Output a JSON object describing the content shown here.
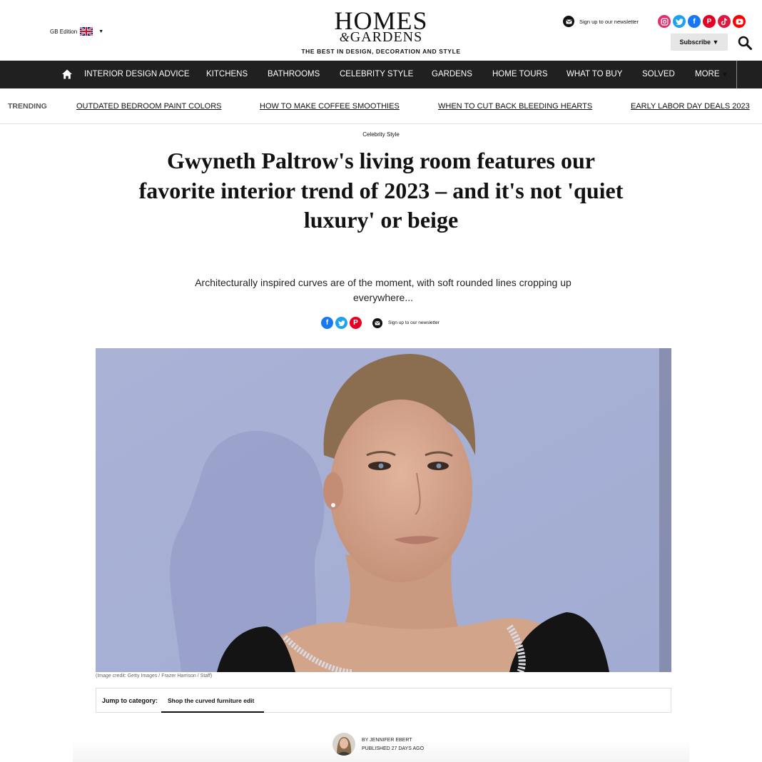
{
  "header": {
    "edition_label": "GB Edition",
    "logo_line1": "HOMES",
    "logo_amp": "&",
    "logo_line2": "GARDENS",
    "tagline": "THE BEST IN DESIGN, DECORATION AND STYLE",
    "newsletter_label": "Sign up to our newsletter",
    "subscribe_label": "Subscribe ▼",
    "socials": [
      {
        "name": "instagram-icon",
        "color": "#e1306c"
      },
      {
        "name": "twitter-icon",
        "color": "#1da1f2"
      },
      {
        "name": "facebook-icon",
        "color": "#1877f2"
      },
      {
        "name": "pinterest-icon",
        "color": "#e60023"
      },
      {
        "name": "tiktok-icon",
        "color": "#e0183c"
      },
      {
        "name": "youtube-icon",
        "color": "#ff0000"
      }
    ]
  },
  "nav": {
    "items": [
      "INTERIOR DESIGN ADVICE",
      "KITCHENS",
      "BATHROOMS",
      "CELEBRITY STYLE",
      "GARDENS",
      "HOME TOURS",
      "WHAT TO BUY",
      "SOLVED",
      "MORE"
    ]
  },
  "trending": {
    "label": "TRENDING",
    "links": [
      "OUTDATED BEDROOM PAINT COLORS",
      "HOW TO MAKE COFFEE SMOOTHIES",
      "WHEN TO CUT BACK BLEEDING HEARTS",
      "EARLY LABOR DAY DEALS 2023"
    ]
  },
  "article": {
    "category": "Celebrity Style",
    "headline": "Gwyneth Paltrow's living room features our favorite interior trend of 2023 – and it's not 'quiet luxury' or beige",
    "standfirst": "Architecturally inspired curves are of the moment, with soft rounded lines cropping up everywhere...",
    "share_newsletter_label": "Sign up to our newsletter",
    "image_credit": "(Image credit: Getty Images / Frazer Harrison / Staff)",
    "jump_label": "Jump to category:",
    "jump_link": "Shop the curved furniture edit",
    "byline_name": "BY JENNIFER EBERT",
    "byline_date": "PUBLISHED 27 DAYS AGO"
  },
  "colors": {
    "nav_bg": "#202020",
    "hero_bg": "#a9b3d7",
    "facebook": "#1877f2",
    "twitter": "#1da1f2",
    "pinterest": "#e60023"
  }
}
